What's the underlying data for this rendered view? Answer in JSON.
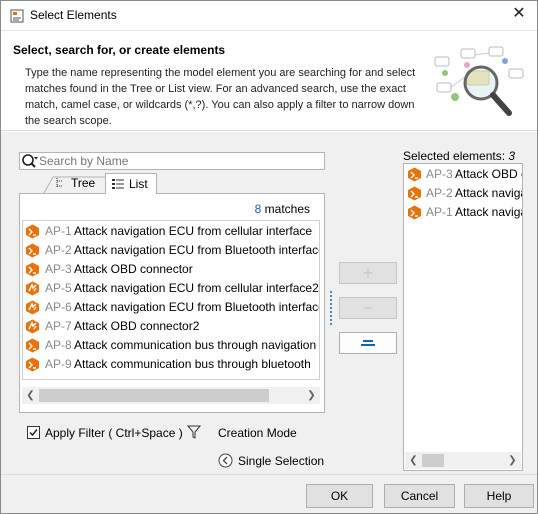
{
  "window": {
    "title": "Select Elements",
    "close_icon": "close-icon"
  },
  "header": {
    "title": "Select, search for, or create elements",
    "description": "Type the name representing the model element you are searching for and select matches found in the Tree or List view. For an advanced search, use the exact match, camel case, or wildcards (*,?). You can also apply a filter to narrow down the search scope."
  },
  "search": {
    "placeholder": "Search by Name",
    "value": ""
  },
  "tabs": [
    {
      "label": "Tree",
      "icon": "tree-icon",
      "selected": false
    },
    {
      "label": "List",
      "icon": "list-icon",
      "selected": true
    }
  ],
  "results": {
    "count": "8",
    "count_suffix": " matches",
    "items": [
      {
        "id": "AP-1",
        "name": "Attack navigation ECU from cellular interface",
        "icon": "attack-pattern-icon"
      },
      {
        "id": "AP-2",
        "name": "Attack navigation ECU from Bluetooth interface",
        "icon": "attack-pattern-icon"
      },
      {
        "id": "AP-3",
        "name": "Attack OBD connector",
        "icon": "attack-pattern-icon"
      },
      {
        "id": "AP-5",
        "name": "Attack navigation ECU from cellular interface2",
        "icon": "attack-pattern-variant-icon"
      },
      {
        "id": "AP-6",
        "name": "Attack navigation ECU from Bluetooth interface",
        "icon": "attack-pattern-variant-icon"
      },
      {
        "id": "AP-7",
        "name": "Attack OBD connector2",
        "icon": "attack-pattern-variant-icon"
      },
      {
        "id": "AP-8",
        "name": "Attack communication bus through navigation",
        "icon": "attack-pattern-icon"
      },
      {
        "id": "AP-9",
        "name": "Attack communication bus through bluetooth",
        "icon": "attack-pattern-icon"
      }
    ]
  },
  "transfer": {
    "add_label": "+",
    "remove_label": "−"
  },
  "selected": {
    "title": "Selected elements: ",
    "count": "3",
    "items": [
      {
        "id": "AP-3",
        "name": "Attack OBD c",
        "icon": "attack-pattern-icon"
      },
      {
        "id": "AP-2",
        "name": "Attack naviga",
        "icon": "attack-pattern-icon"
      },
      {
        "id": "AP-1",
        "name": "Attack naviga",
        "icon": "attack-pattern-icon"
      }
    ]
  },
  "options": {
    "apply_filter_label": "Apply Filter ( Ctrl+Space )",
    "apply_filter_checked": true,
    "creation_mode_label": "Creation Mode",
    "single_selection_label": "Single Selection"
  },
  "footer": {
    "ok_label": "OK",
    "cancel_label": "Cancel",
    "help_label": "Help"
  },
  "colors": {
    "accent_blue": "#1a5fb4",
    "icon_orange": "#e8720c",
    "id_gray": "#8a8a8a"
  }
}
